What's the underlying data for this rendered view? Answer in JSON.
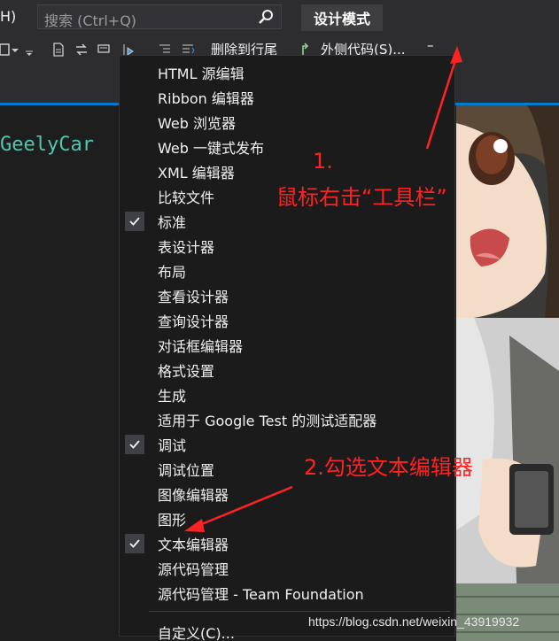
{
  "titlebar": {
    "menu_partial": "H)",
    "search_placeholder": "搜索 (Ctrl+Q)",
    "design_mode": "设计模式"
  },
  "toolbar": {
    "delete_to_line_end": "删除到行尾",
    "outer_code": "外侧代码(S)..."
  },
  "editor": {
    "code_text": "GeelyCar"
  },
  "context_menu": {
    "items": [
      {
        "label": "HTML 源编辑",
        "checked": false
      },
      {
        "label": "Ribbon 编辑器",
        "checked": false
      },
      {
        "label": "Web 浏览器",
        "checked": false
      },
      {
        "label": "Web 一键式发布",
        "checked": false
      },
      {
        "label": "XML 编辑器",
        "checked": false
      },
      {
        "label": "比较文件",
        "checked": false
      },
      {
        "label": "标准",
        "checked": true
      },
      {
        "label": "表设计器",
        "checked": false
      },
      {
        "label": "布局",
        "checked": false
      },
      {
        "label": "查看设计器",
        "checked": false
      },
      {
        "label": "查询设计器",
        "checked": false
      },
      {
        "label": "对话框编辑器",
        "checked": false
      },
      {
        "label": "格式设置",
        "checked": false
      },
      {
        "label": "生成",
        "checked": false
      },
      {
        "label": "适用于 Google Test 的测试适配器",
        "checked": false
      },
      {
        "label": "调试",
        "checked": true
      },
      {
        "label": "调试位置",
        "checked": false
      },
      {
        "label": "图像编辑器",
        "checked": false
      },
      {
        "label": "图形",
        "checked": false
      },
      {
        "label": "文本编辑器",
        "checked": true
      },
      {
        "label": "源代码管理",
        "checked": false
      },
      {
        "label": "源代码管理 - Team Foundation",
        "checked": false
      }
    ],
    "customize": "自定义(C)..."
  },
  "annotations": {
    "step1_num": "1.",
    "step1_text": "鼠标右击“工具栏”",
    "step2_text": "2.勾选文本编辑器",
    "color": "#ff2222"
  },
  "watermark": "https://blog.csdn.net/weixin_43919932",
  "colors": {
    "accent": "#007acc",
    "code_type": "#4ec9b0"
  }
}
